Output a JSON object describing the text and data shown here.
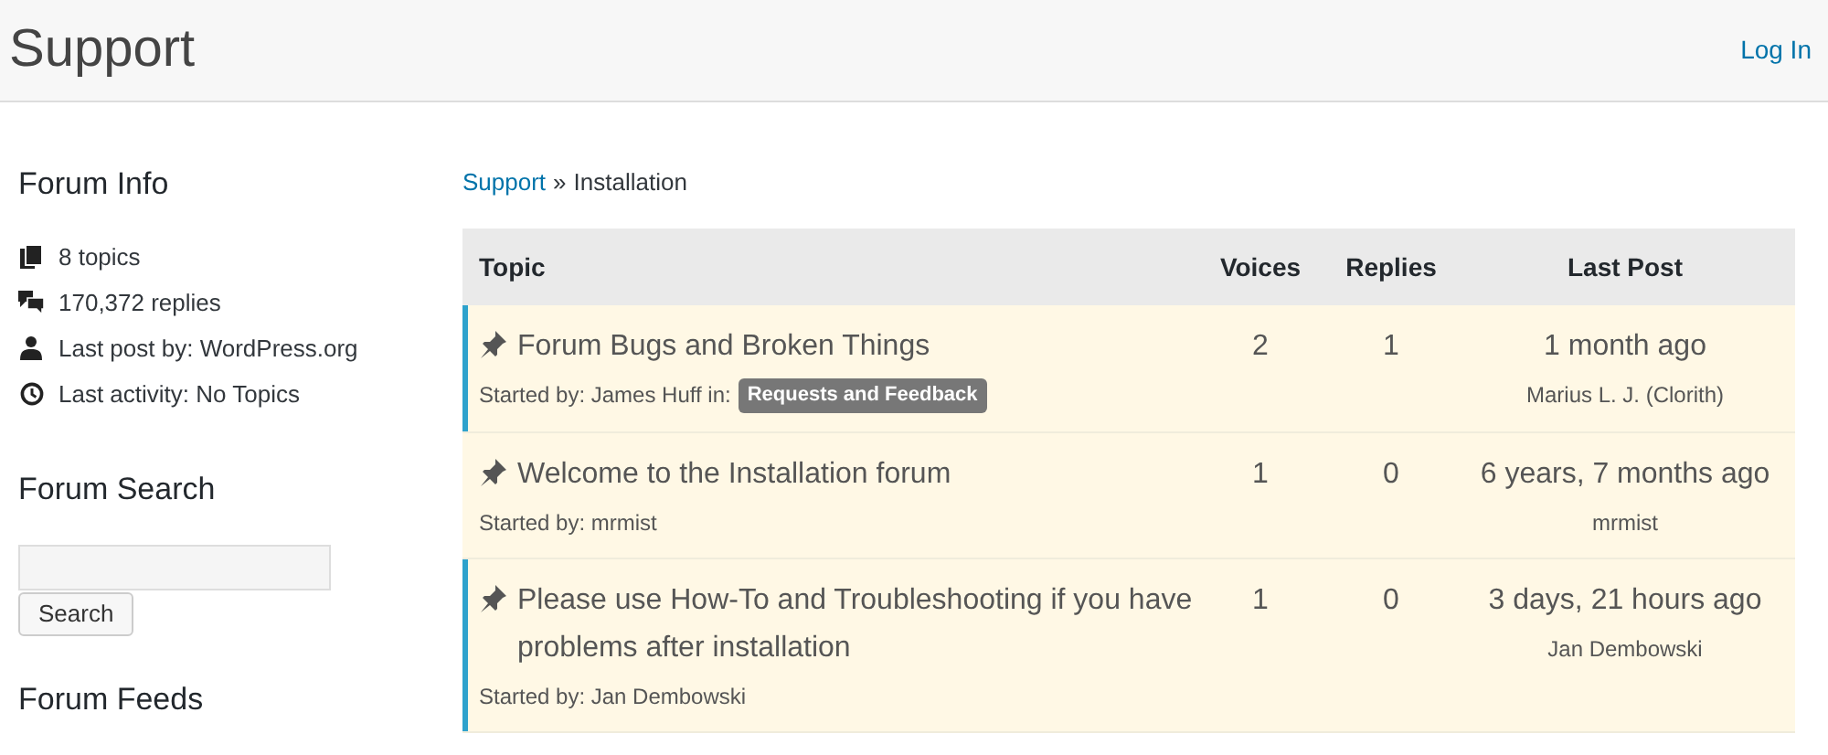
{
  "header": {
    "title": "Support",
    "login": "Log In"
  },
  "sidebar": {
    "info_title": "Forum Info",
    "stats": [
      {
        "kind": "topics",
        "text": "8 topics"
      },
      {
        "kind": "replies",
        "text": "170,372 replies"
      },
      {
        "kind": "user",
        "text": "Last post by: WordPress.org"
      },
      {
        "kind": "clock",
        "text": "Last activity: No Topics"
      }
    ],
    "search_title": "Forum Search",
    "search_button": "Search",
    "feeds_title": "Forum Feeds"
  },
  "breadcrumb": {
    "link": "Support",
    "separator": "»",
    "current": "Installation"
  },
  "table": {
    "columns": [
      "Topic",
      "Voices",
      "Replies",
      "Last Post"
    ],
    "rows": [
      {
        "title": "Forum Bugs and Broken Things",
        "started_by": "Started by: James Huff in:",
        "tag": "Requests and Feedback",
        "voices": "2",
        "replies": "1",
        "last_post": "1 month ago",
        "last_author": "Marius L. J. (Clorith)",
        "highlighted": true
      },
      {
        "title": "Welcome to the Installation forum",
        "started_by": "Started by: mrmist",
        "voices": "1",
        "replies": "0",
        "last_post": "6 years, 7 months ago",
        "last_author": "mrmist",
        "highlighted": false
      },
      {
        "title": "Please use How-To and Troubleshooting if you have problems after installation",
        "started_by": "Started by: Jan Dembowski",
        "voices": "1",
        "replies": "0",
        "last_post": "3 days, 21 hours ago",
        "last_author": "Jan Dembowski",
        "highlighted": true
      }
    ]
  }
}
